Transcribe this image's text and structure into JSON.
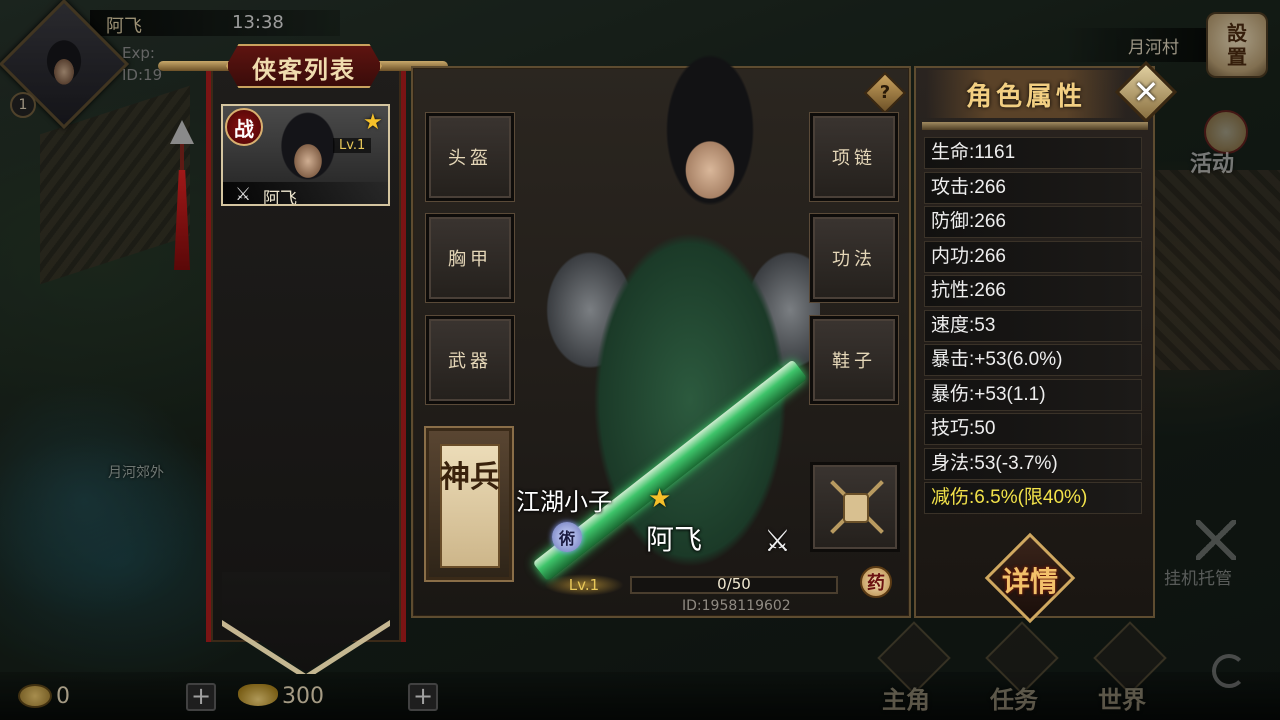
{
  "player": {
    "name": "阿飞",
    "time": "13:38",
    "exp_label": "Exp:",
    "id_label": "ID:19",
    "level": "1"
  },
  "map": {
    "current_area": "月河村",
    "outskirts_label": "月河郊外"
  },
  "settings": {
    "line1": "設",
    "line2": "置",
    "icon": "settings-seal"
  },
  "activity": {
    "label": "活动"
  },
  "idle": {
    "label": "挂机托管"
  },
  "hero_list": {
    "title": "侠客列表",
    "heroes": [
      {
        "name": "阿飞",
        "level": "Lv.1",
        "badge": "战",
        "stars": 1,
        "icon": "sword-icon"
      }
    ]
  },
  "equipment": {
    "left": [
      "头盔",
      "胸甲",
      "武器"
    ],
    "right": [
      "项链",
      "功法",
      "鞋子"
    ],
    "divine_weapon": "神兵",
    "locked_slot_icon": "lock-icon"
  },
  "hero": {
    "title": "江湖小子",
    "class_badge": "術",
    "name": "阿飞",
    "level": "Lv.1",
    "exp_text": "0/50",
    "exp_progress": 0,
    "medicine_badge": "药",
    "id_text": "ID:1958119602"
  },
  "attributes": {
    "title": "角色属性",
    "rows": [
      "生命:1161",
      "攻击:266",
      "防御:266",
      "内功:266",
      "抗性:266",
      "速度:53",
      "暴击:+53(6.0%)",
      "暴伤:+53(1.1)",
      "技巧:50",
      "身法:53(-3.7%)",
      "减伤:6.5%(限40%)"
    ],
    "highlight_index": 10,
    "details_button": "详情",
    "highlight_color": "#f2e24a"
  },
  "bottom": {
    "copper": "0",
    "gold": "300",
    "plus": "+",
    "nav": [
      "主角",
      "任务",
      "世界"
    ]
  }
}
